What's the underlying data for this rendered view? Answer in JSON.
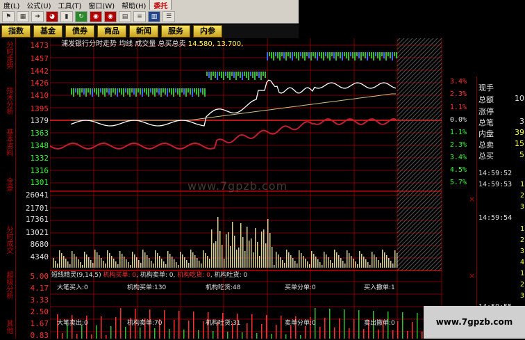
{
  "menu": {
    "items": [
      "度(L)",
      "公式(U)",
      "工具(T)",
      "窗口(W)",
      "帮助(H)"
    ],
    "active": "委托"
  },
  "toolbar": {
    "icons": [
      "flag-icon",
      "grid-icon",
      "arrow-right-icon",
      "pie-chart-icon",
      "candle-icon",
      "refresh-icon",
      "disc-icon",
      "disc-icon",
      "notepad-icon",
      "stack-icon",
      "bars-icon",
      "list-icon"
    ]
  },
  "nav": [
    "指数",
    "基金",
    "债券",
    "商品",
    "新闻",
    "服务",
    "内参"
  ],
  "sidebar": [
    "分时走势",
    "技术分析",
    "基本资料",
    "全景",
    "分时成交",
    "超级分析",
    "其他"
  ],
  "chart_title": {
    "stock": "浦发银行分时走势",
    "legend": "均线 成交量 总买总卖",
    "values": "14.580, 13.700,"
  },
  "price_axis": {
    "labels": [
      "1473",
      "1457",
      "1442",
      "1426",
      "1410",
      "1395",
      "1379",
      "1363",
      "1348",
      "1332",
      "1316",
      "1301"
    ],
    "percent": [
      "3.4%",
      "2.3%",
      "1.1%",
      "0.0%",
      "1.1%",
      "2.3%",
      "3.4%",
      "4.5%",
      "5.7%"
    ]
  },
  "volume_axis": {
    "labels": [
      "26041",
      "21701",
      "17361",
      "13021",
      "8680",
      "4340"
    ]
  },
  "indicator_axis": {
    "labels": [
      "5.00",
      "4.17",
      "3.33",
      "2.50",
      "1.67",
      "0.83"
    ]
  },
  "indicator_header": {
    "name": "短线精灵(9,14,5)",
    "f1": "机构买单: 0",
    "f2": "机构卖单: 0",
    "f3": "机构吃货: 0",
    "f4": "机构吐货: 0"
  },
  "stats_row1": {
    "a": "大笔买入:0",
    "b": "机构买单:130",
    "c": "机构吃货:48",
    "d": "买单分单:0",
    "e": "买入撤单:1"
  },
  "stats_row2": {
    "a": "大笔卖出:0",
    "b": "机构卖单:70",
    "c": "机构吐货:31",
    "d": "卖单分单:0",
    "e": "卖出撤单:0"
  },
  "right_panel": {
    "rows": [
      {
        "k": "现手",
        "v": ""
      },
      {
        "k": "总额",
        "v": "10"
      },
      {
        "k": "涨停",
        "v": ""
      },
      {
        "k": "总笔",
        "v": "3"
      },
      {
        "k": "内盘",
        "v": "39"
      },
      {
        "k": "总卖",
        "v": "15"
      },
      {
        "k": "总买",
        "v": "5"
      }
    ],
    "ticks": [
      {
        "t": "14:59:52",
        "v": ""
      },
      {
        "t": "14:59:53",
        "v": "1"
      },
      {
        "t": "",
        "v": "2"
      },
      {
        "t": "",
        "v": "3"
      },
      {
        "t": "14:59:54",
        "v": ""
      },
      {
        "t": "",
        "v": "1"
      },
      {
        "t": "",
        "v": "2"
      },
      {
        "t": "",
        "v": "3"
      },
      {
        "t": "",
        "v": "4"
      },
      {
        "t": "",
        "v": "1"
      },
      {
        "t": "",
        "v": "2"
      },
      {
        "t": "",
        "v": "3"
      },
      {
        "t": "14:59:55",
        "v": ""
      }
    ]
  },
  "watermark": "www.7gpzb.com",
  "corner_watermark": "www.7gpzb.com",
  "colors": {
    "up": "#ff3030",
    "down": "#30ff30",
    "grid": "#a00000",
    "nav_button": "#e0c040"
  }
}
